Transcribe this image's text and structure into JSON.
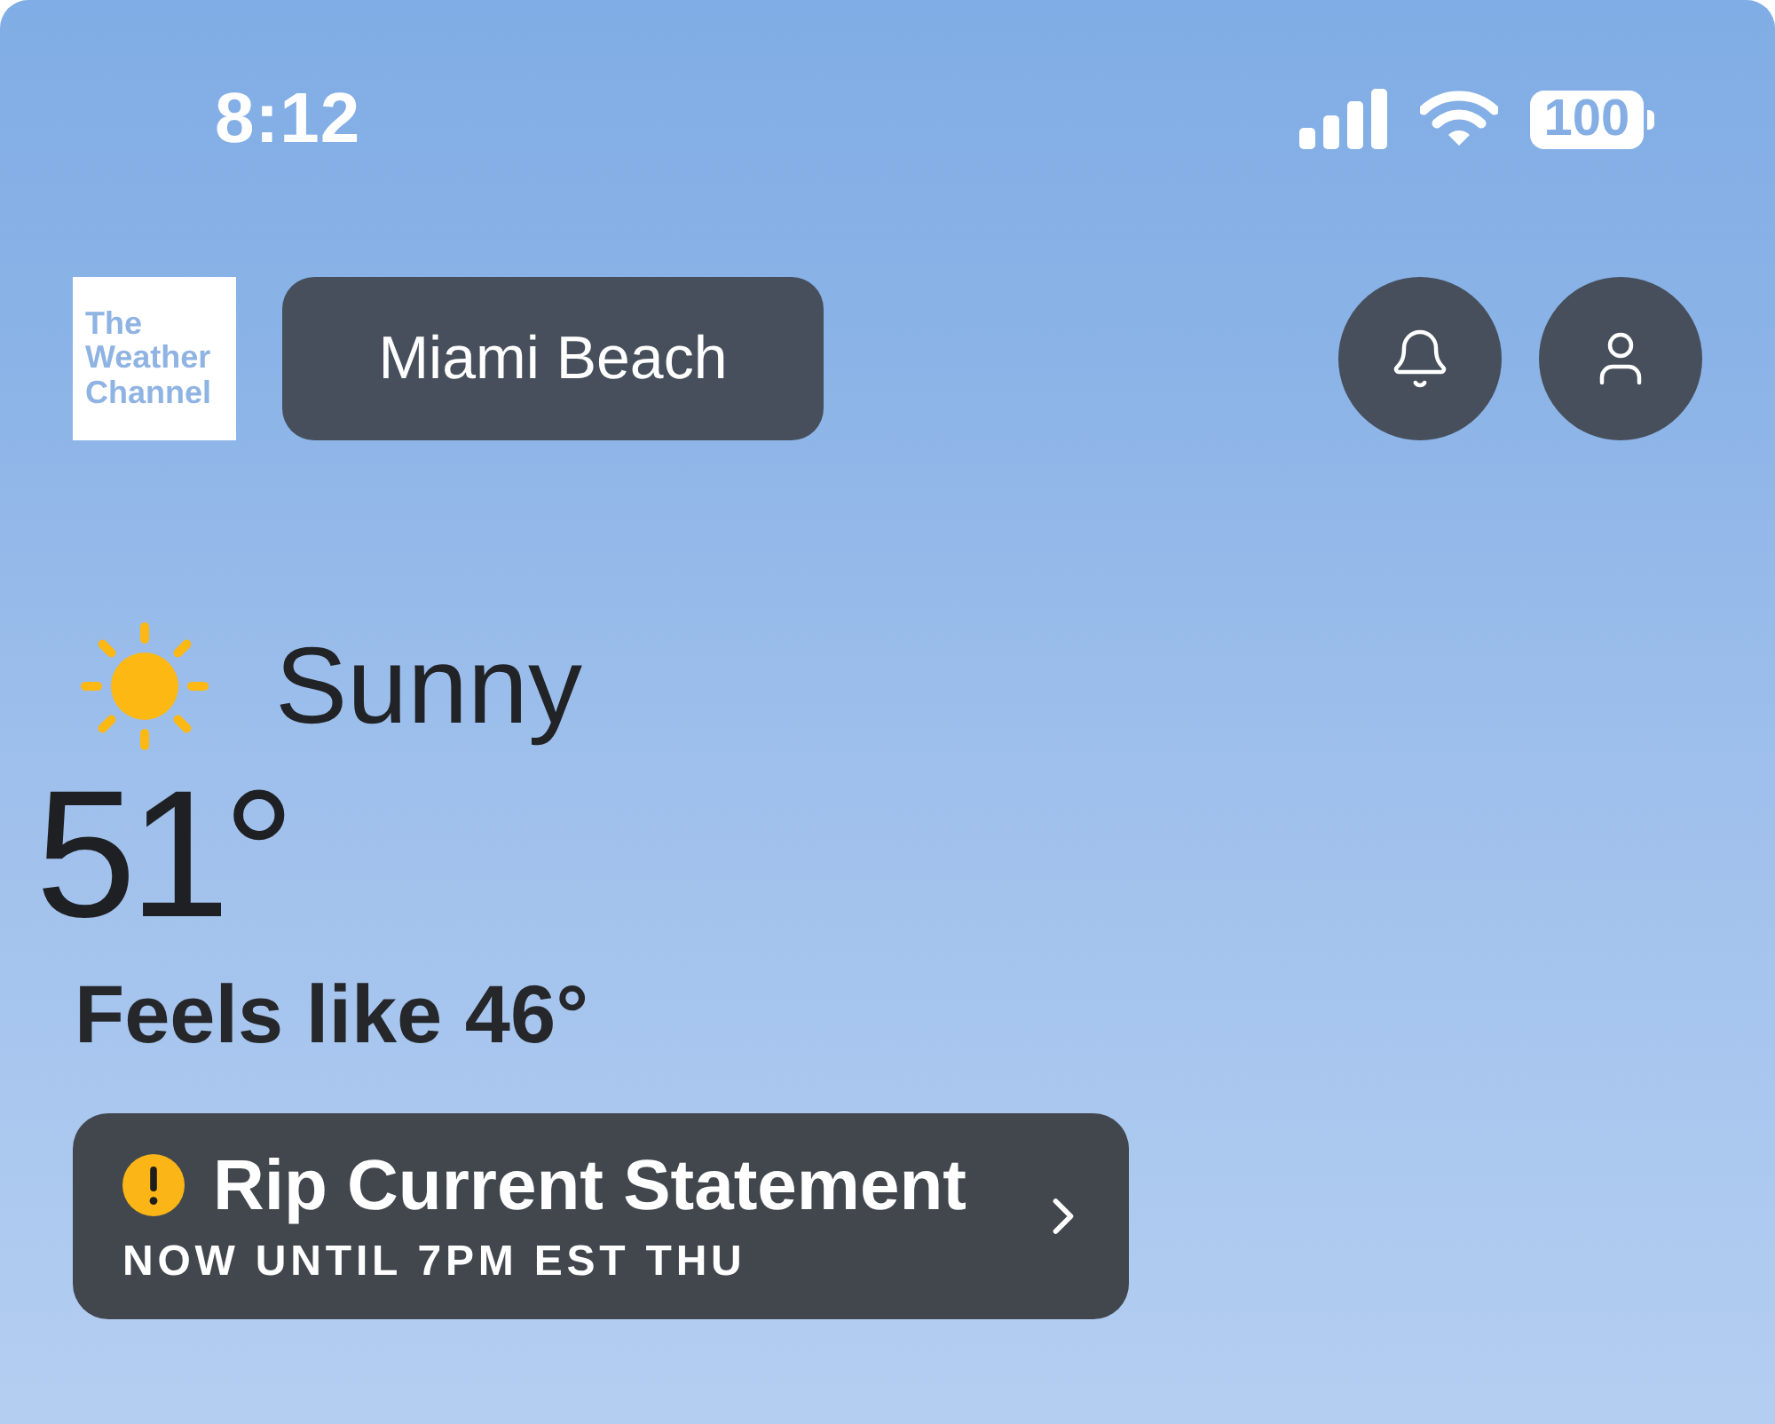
{
  "status_bar": {
    "time": "8:12",
    "battery": "100"
  },
  "header": {
    "logo_text": "The Weather Channel",
    "location": "Miami Beach"
  },
  "current": {
    "condition": "Sunny",
    "temperature": "51°",
    "feels_like": "Feels like 46°"
  },
  "alert": {
    "title": "Rip Current Statement",
    "subtitle": "NOW UNTIL 7PM EST THU"
  }
}
